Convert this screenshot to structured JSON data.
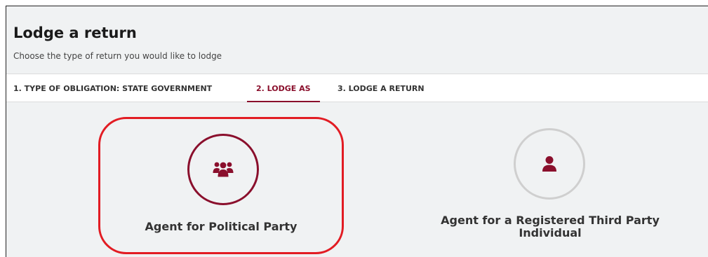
{
  "header": {
    "title": "Lodge a return",
    "subtitle": "Choose the type of return you would like to lodge"
  },
  "steps": [
    {
      "label": "1. TYPE OF OBLIGATION: STATE GOVERNMENT",
      "active": false
    },
    {
      "label": "2. LODGE AS",
      "active": true
    },
    {
      "label": "3. LODGE A RETURN",
      "active": false
    }
  ],
  "options": [
    {
      "label": "Agent for Political Party",
      "icon": "group-icon",
      "selected": true
    },
    {
      "label_line1": "Agent for a Registered Third Party",
      "label_line2": "Individual",
      "icon": "person-icon",
      "selected": false
    }
  ],
  "colors": {
    "accent": "#8a0f2c",
    "selection_outline": "#e21c23",
    "background": "#f0f2f3",
    "inactive_circle": "#cfcfcf"
  }
}
